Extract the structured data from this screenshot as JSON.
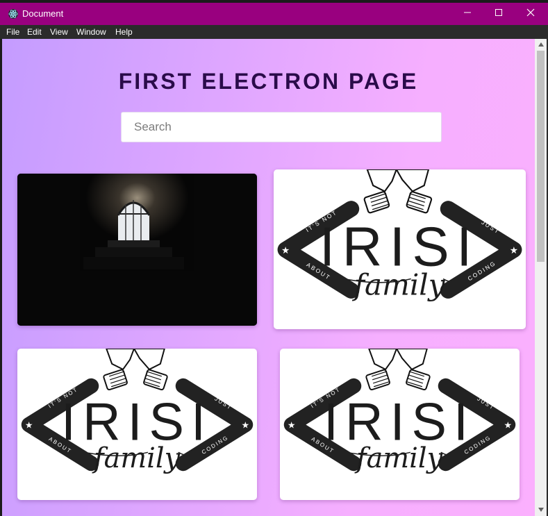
{
  "window": {
    "title": "Document",
    "titlebar_color": "#99007f",
    "controls": [
      "minimize-icon",
      "maximize-icon",
      "close-icon"
    ]
  },
  "menu": {
    "items": [
      "File",
      "Edit",
      "View",
      "Window",
      "Help"
    ]
  },
  "page": {
    "heading": "FIRST ELECTRON PAGE",
    "search": {
      "placeholder": "Search",
      "value": ""
    }
  },
  "cards": [
    {
      "image": "dark-corridor-doorway-photo"
    },
    {
      "image": "irisi-family-logo"
    },
    {
      "image": "irisi-family-logo"
    },
    {
      "image": "irisi-family-logo"
    }
  ],
  "logo": {
    "brand": "IRISI",
    "script": "family",
    "arc_left_top": "IT'S NOT",
    "arc_left_bottom": "ABOUT",
    "arc_right_top": "JUST",
    "arc_right_bottom": "CODING"
  }
}
